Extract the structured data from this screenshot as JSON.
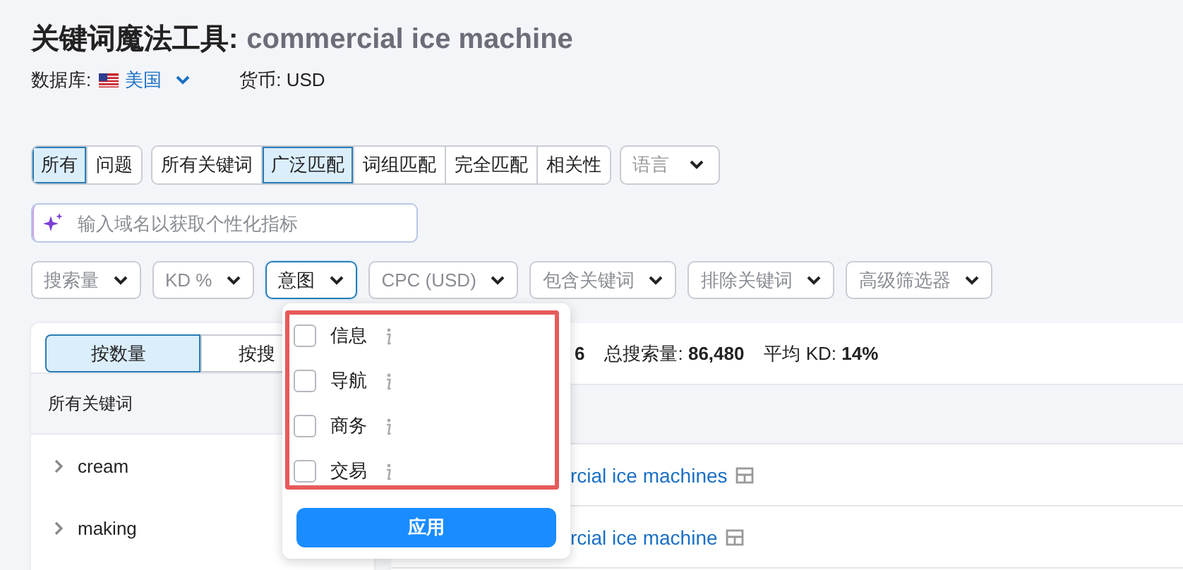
{
  "header": {
    "title": "关键词魔法工具:",
    "query": "commercial ice machine",
    "database_label": "数据库:",
    "database": "美国",
    "currency": "货币: USD"
  },
  "segments": [
    [
      {
        "label": "所有",
        "selected": true
      },
      {
        "label": "问题",
        "selected": false
      }
    ],
    [
      {
        "label": "所有关键词",
        "selected": false
      },
      {
        "label": "广泛匹配",
        "selected": true
      },
      {
        "label": "词组匹配",
        "selected": false
      },
      {
        "label": "完全匹配",
        "selected": false
      },
      {
        "label": "相关性",
        "selected": false
      }
    ]
  ],
  "language": {
    "placeholder": "语言"
  },
  "domain_field": {
    "placeholder": "输入域名以获取个性化指标"
  },
  "filters": [
    {
      "label": "搜索量",
      "open": false
    },
    {
      "label": "KD %",
      "open": false
    },
    {
      "label": "意图",
      "open": true
    },
    {
      "label": "CPC (USD)",
      "open": false
    },
    {
      "label": "包含关键词",
      "open": false
    },
    {
      "label": "排除关键词",
      "open": false
    },
    {
      "label": "高级筛选器",
      "open": false
    }
  ],
  "intent_menu": {
    "options": [
      {
        "label": "信息",
        "checked": false
      },
      {
        "label": "导航",
        "checked": false
      },
      {
        "label": "商务",
        "checked": false
      },
      {
        "label": "交易",
        "checked": false
      }
    ],
    "apply": "应用"
  },
  "groups_panel": {
    "tabs": [
      {
        "label": "按数量",
        "selected": true
      },
      {
        "label": "按搜",
        "selected": false
      }
    ],
    "column": "所有关键词",
    "rows": [
      "cream",
      "making"
    ]
  },
  "results": {
    "count": "6",
    "stats": [
      "总搜索量: **86,480**",
      "平均 KD: **14%**"
    ],
    "rows": [
      "rcial ice machines",
      "rcial ice machine"
    ]
  }
}
